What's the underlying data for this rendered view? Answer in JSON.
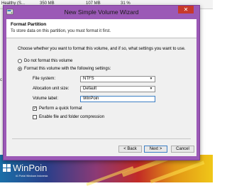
{
  "background": {
    "list_row": {
      "name": "Healthy (S...",
      "capacity": "350 MB",
      "free": "107 MB",
      "percent": "31 %"
    },
    "left_hint": "c",
    "brand_name": "WinPoin",
    "brand_tagline": "#1 Portal Windows Indonesia"
  },
  "dialog": {
    "title": "New Simple Volume Wizard",
    "close_glyph": "✕",
    "header": {
      "title": "Format Partition",
      "subtitle": "To store data on this partition, you must format it first."
    },
    "question": "Choose whether you want to format this volume, and if so, what settings you want to use.",
    "options": {
      "no_format": "Do not format this volume",
      "format": "Format this volume with the following settings:",
      "selected": "format"
    },
    "fields": {
      "file_system_label": "File system:",
      "file_system_value": "NTFS",
      "allocation_label": "Allocation unit size:",
      "allocation_value": "Default",
      "volume_label_label": "Volume label:",
      "volume_label_value": "WinPoin"
    },
    "checkboxes": {
      "quick_format": "Perform a quick format",
      "quick_format_checked": true,
      "compression": "Enable file and folder compression",
      "compression_checked": false
    },
    "buttons": {
      "back": "< Back",
      "next": "Next >",
      "cancel": "Cancel"
    }
  },
  "colors": {
    "window_frame": "#9b59b6",
    "close_button": "#c7392b",
    "focus_border": "#3c7fc4"
  }
}
